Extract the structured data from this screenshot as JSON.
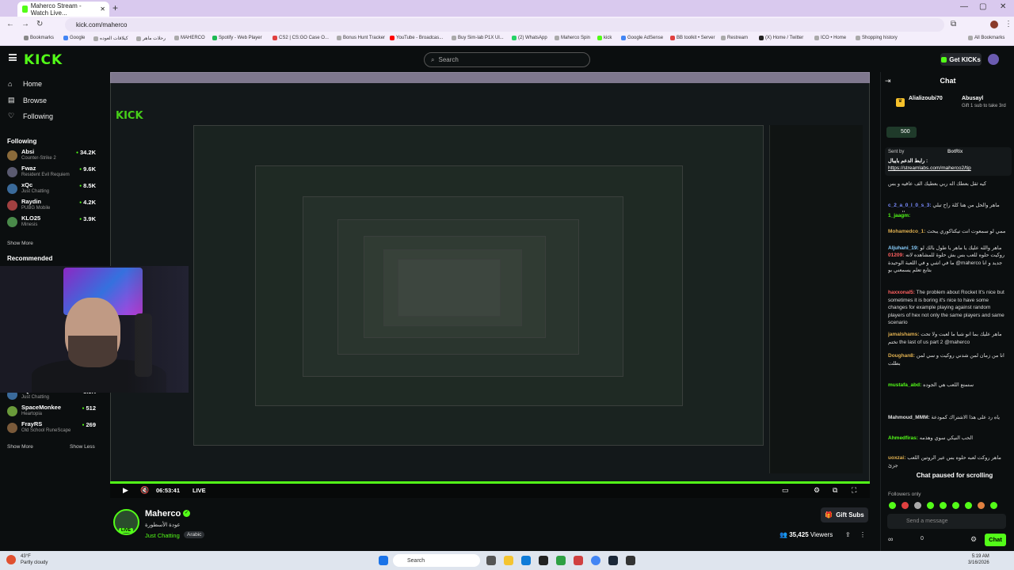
{
  "browser": {
    "tab_title": "Maherco Stream - Watch Live...",
    "url": "kick.com/maherco",
    "bookmarks": [
      "Bookmarks",
      "Google",
      "کیلاقات العوده",
      "رحلات ماهر",
      "MAHERCO",
      "Spotify - Web Player",
      "CS2 | CS:GO Case O...",
      "Bonus Hunt Tracker",
      "YouTube - Broadcas...",
      "Buy Sim-lab P1X Ul...",
      "(2) WhatsApp",
      "Maherco Spin",
      "kick",
      "Google AdSense",
      "BB toolkit • Server",
      "Restream",
      "(X) Home / Twitter",
      "ICO • Home",
      "Shopping history",
      "All Bookmarks"
    ]
  },
  "header": {
    "logo": "KICK",
    "search_placeholder": "Search",
    "get_kicks": "Get KICKs"
  },
  "sidebar": {
    "nav": [
      {
        "label": "Home",
        "icon": "home-icon"
      },
      {
        "label": "Browse",
        "icon": "browse-icon"
      },
      {
        "label": "Following",
        "icon": "heart-icon"
      }
    ],
    "following_heading": "Following",
    "following": [
      {
        "name": "Absi",
        "category": "Counter-Strike 2",
        "viewers": "34.2K",
        "color": "#8a6a3a"
      },
      {
        "name": "Fwaz",
        "category": "Resident Evil Requiem",
        "viewers": "9.6K",
        "color": "#5a5a70"
      },
      {
        "name": "xQc",
        "category": "Just Chatting",
        "viewers": "8.5K",
        "color": "#3a6a9a"
      },
      {
        "name": "Raydin",
        "category": "PUBG Mobile",
        "viewers": "4.2K",
        "color": "#a04040"
      },
      {
        "name": "KLO25",
        "category": "Minesis",
        "viewers": "3.9K",
        "color": "#4a8a4a"
      }
    ],
    "show_more": "Show More",
    "recommended_heading": "Recommended",
    "recommended": [
      {
        "name": "xQc",
        "category": "Just Chatting",
        "viewers": "8.5K",
        "color": "#3a6a9a"
      },
      {
        "name": "SpaceMonkee",
        "category": "Heartopia",
        "viewers": "512",
        "color": "#6a9a3a"
      },
      {
        "name": "FrayRS",
        "category": "Old School RuneScape",
        "viewers": "269",
        "color": "#7a5a3a"
      }
    ],
    "rec_show_more": "Show More",
    "rec_show_less": "Show Less"
  },
  "player": {
    "time": "06:53:41",
    "live": "LIVE",
    "progress_percent": 100
  },
  "stream_info": {
    "streamer": "Maherco",
    "title": "عودة الأسطورة",
    "category": "Just Chatting",
    "tag": "Arabic",
    "gift_subs": "Gift Subs",
    "viewers_count": "35,425",
    "viewers_label": "Viewers"
  },
  "chat": {
    "title": "Chat",
    "pinned_user": "Alializoubi70",
    "pinned_gifter": "Abusayl",
    "pinned_text": "Gift 1 sub to take 3rd",
    "kicks_value": "500",
    "sent_by": "Sent by",
    "sent_by_user": "BotRix",
    "link_label": "رابط الدعم بايبال :",
    "link_url": "https://streamlabs.com/maherco2/tip",
    "messages": [
      {
        "user": "",
        "text": "كيه ثقل بعطك اله ربي بعطيك الف عافيه و بس",
        "color": "#53fc18"
      },
      {
        "user": "c_2_a_0_l_0_s_3:",
        "text": "ماهر والحل من هنا كلة راح تبلي تسمع الجمهور",
        "color": "#7a8cff"
      },
      {
        "user": "1_jaagm:",
        "text": "",
        "color": "#53fc18"
      },
      {
        "user": "Mohamedco_1:",
        "text": "ممي لو سمعوت انت تيكتاكوري يبحث",
        "color": "#e0b050"
      },
      {
        "user": "Aljuhani_19:",
        "text": "ماهر والله عليك يا ماهر يا طول بالك لو احد عيرك",
        "color": "#8ad0ff"
      },
      {
        "user": "01209:",
        "text": "روكيت حلوه للعب بس بش حلوة للمشاهده لانه ما في اشي و في اللعبة الوحيدة @maherco جديد و انا بتابع تعلم يسمعني بو",
        "color": "#ff6060"
      },
      {
        "user": "haxxonal5:",
        "text": "The problem about Rocket It's nice but sometimes it is boring it's nice to have some changes for example playing against random players of hex not only the same players and same scenario",
        "color": "#ff6060"
      },
      {
        "user": "jamalshams:",
        "text": "ماهر عليك بما انو شبا ما لعبت ولا تحت تختم the last of us part 2 @maherco",
        "color": "#e0b050"
      },
      {
        "user": "Doughan8:",
        "text": "انا من زمان لمن شدني روكيت و سي لمن بطلت",
        "color": "#e0b050"
      },
      {
        "user": "mustafa_abd:",
        "text": "ستمتع اللعب هي الجوده",
        "color": "#53fc18"
      },
      {
        "user": "Mahmoud_MMM:",
        "text": "ياه رد على هذا الاشتراك كمودعة",
        "color": "#e0e0e0"
      },
      {
        "user": "Ahmedfiras:",
        "text": "الحب النيكي سوي وهذمه",
        "color": "#53fc18"
      },
      {
        "user": "uoxzai:",
        "text": "ماهر روكت لعبه حلوه بس عير الروتين اللعب جزئ",
        "color": "#e0b050"
      }
    ],
    "paused": "Chat paused for scrolling",
    "followers_only": "Followers only",
    "input_placeholder": "Send a message",
    "chat_button": "Chat",
    "kicks_count": "0"
  },
  "taskbar": {
    "temp": "43°F",
    "weather": "Partly cloudy",
    "search": "Search",
    "time": "5:19 AM",
    "date": "3/16/2026"
  },
  "colors": {
    "accent": "#53fc18",
    "bg": "#0b0e0f"
  }
}
